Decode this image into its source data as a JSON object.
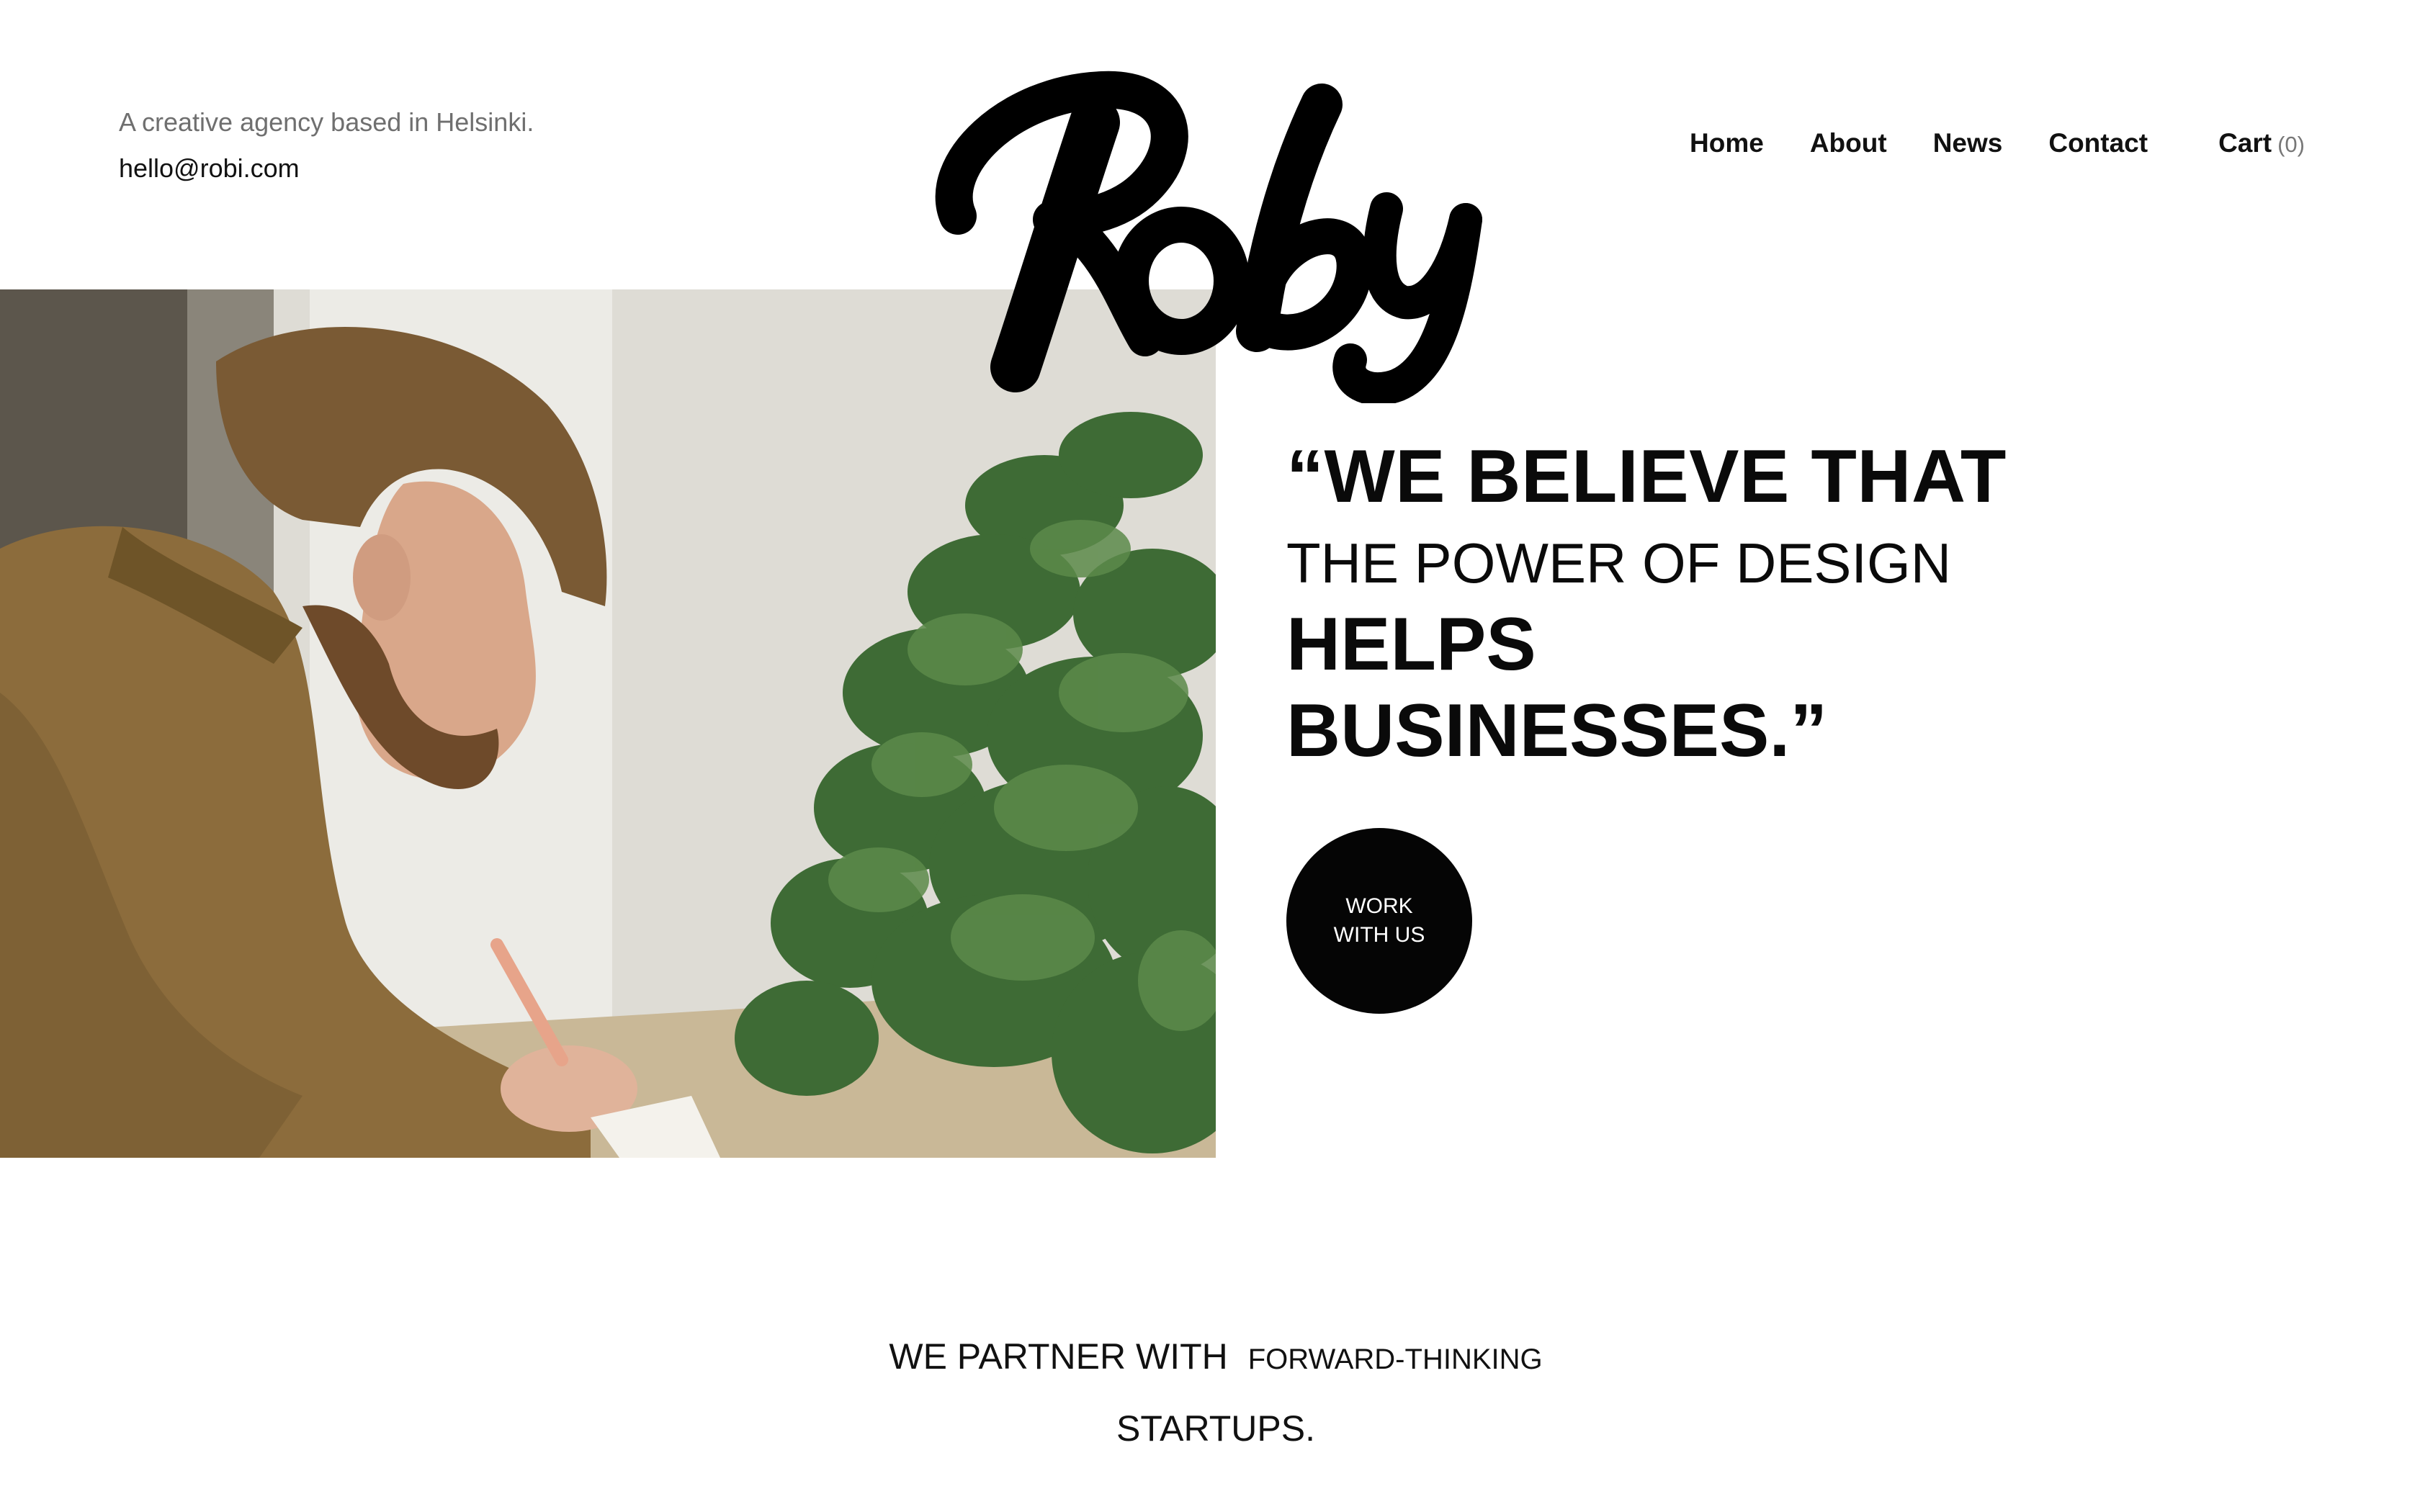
{
  "header": {
    "tagline": "A creative agency based in Helsinki.",
    "email": "hello@robi.com",
    "logo_text": "Roby"
  },
  "nav": {
    "items": [
      {
        "label": "Home"
      },
      {
        "label": "About"
      },
      {
        "label": "News"
      },
      {
        "label": "Contact"
      }
    ],
    "cart_label": "Cart",
    "cart_count": "(0)"
  },
  "hero": {
    "quote_line1": "“We believe that",
    "quote_line2": "the power of design",
    "quote_line3": "helps",
    "quote_line4": "businesses.”",
    "cta_line1": "Work",
    "cta_line2": "with us"
  },
  "partner": {
    "part1": "WE PARTNER WITH",
    "part2": "FORWARD-THINKING",
    "part3": "STARTUPS."
  },
  "colors": {
    "text": "#111111",
    "muted": "#6f6f6f",
    "button_bg": "#050505",
    "background": "#ffffff"
  }
}
